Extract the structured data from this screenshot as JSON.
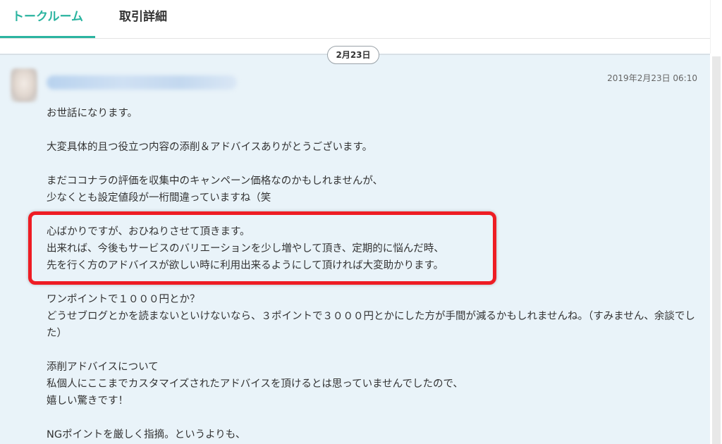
{
  "tabs": [
    {
      "label": "トークルーム",
      "active": true
    },
    {
      "label": "取引詳細",
      "active": false
    }
  ],
  "colors": {
    "accent": "#2bb4a0",
    "chat_background": "#e9f3f9",
    "highlight": "#ee1c24"
  },
  "chat": {
    "date_label": "2月23日",
    "message": {
      "timestamp": "2019年2月23日 06:10",
      "paragraphs": [
        [
          "お世話になります。"
        ],
        [
          "大変具体的且つ役立つ内容の添削＆アドバイスありがとうございます。"
        ],
        [
          "まだココナラの評価を収集中のキャンペーン価格なのかもしれませんが、",
          "少なくとも設定値段が一桁間違っていますね（笑"
        ],
        [
          "心ばかりですが、おひねりさせて頂きます。",
          "出来れば、今後もサービスのバリエーションを少し増やして頂き、定期的に悩んだ時、",
          "先を行く方のアドバイスが欲しい時に利用出来るようにして頂ければ大変助かります。"
        ],
        [
          "ワンポイントで１０００円とか？",
          "どうせブログとかを読まないといけないなら、３ポイントで３０００円とかにした方が手間が減るかもしれませんね。（すみません、余談でした）"
        ],
        [
          "添削アドバイスについて",
          "私個人にここまでカスタマイズされたアドバイスを頂けるとは思っていませんでしたので、",
          "嬉しい驚きです！"
        ],
        [
          "NGポイントを厳しく指摘。というよりも、"
        ]
      ]
    }
  }
}
